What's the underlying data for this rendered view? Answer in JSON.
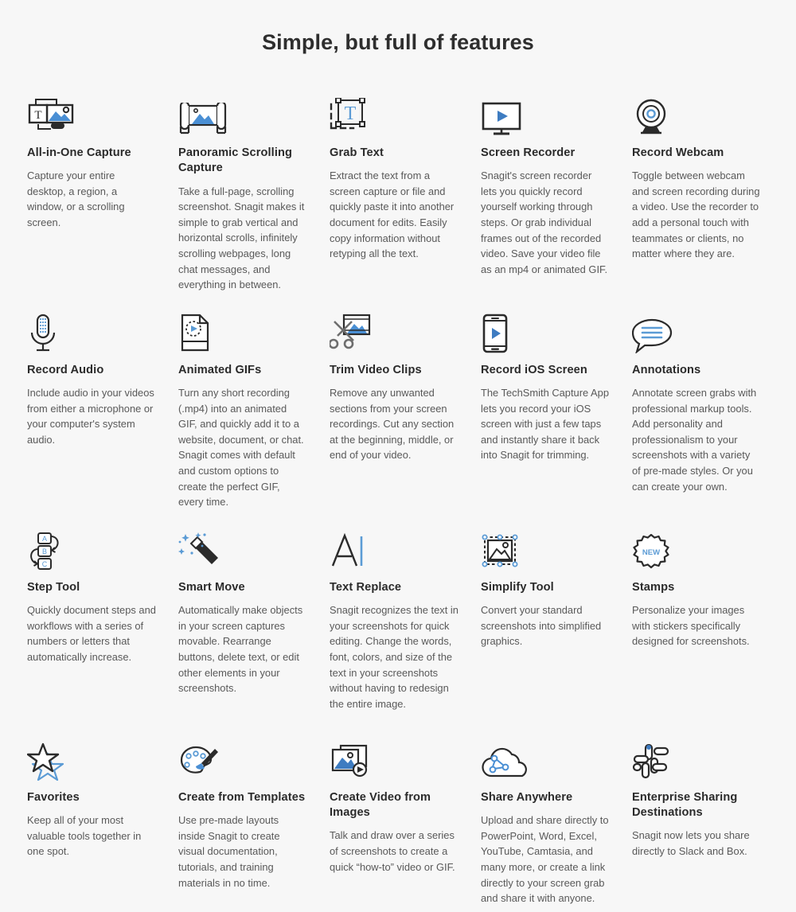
{
  "header": {
    "title": "Simple, but full of features"
  },
  "colors": {
    "accent": "#3e7cc1",
    "accent_light": "#5b9bd5",
    "ink": "#2b2b2b",
    "body_text": "#595959",
    "background": "#f7f7f7"
  },
  "features": [
    {
      "icon": "all-in-one-capture-icon",
      "title": "All-in-One Capture",
      "desc": "Capture your entire desktop, a region, a window, or a scrolling screen."
    },
    {
      "icon": "panoramic-scrolling-capture-icon",
      "title": "Panoramic Scrolling Capture",
      "desc": "Take a full-page, scrolling screenshot. Snagit makes it simple to grab vertical and horizontal scrolls, infinitely scrolling webpages, long chat messages, and everything in between."
    },
    {
      "icon": "grab-text-icon",
      "title": "Grab Text",
      "desc": "Extract the text from a screen capture or file and quickly paste it into another document for edits. Easily copy information without retyping all the text."
    },
    {
      "icon": "screen-recorder-icon",
      "title": "Screen Recorder",
      "desc": "Snagit's screen recorder lets you quickly record yourself working through steps. Or grab individual frames out of the recorded video. Save your video file as an mp4 or animated GIF."
    },
    {
      "icon": "record-webcam-icon",
      "title": "Record Webcam",
      "desc": "Toggle between webcam and screen recording during a video. Use the recorder to add a personal touch with teammates or clients, no matter where they are."
    },
    {
      "icon": "record-audio-icon",
      "title": "Record Audio",
      "desc": "Include audio in your videos from either a microphone or your computer's system audio."
    },
    {
      "icon": "animated-gifs-icon",
      "title": "Animated GIFs",
      "desc": "Turn any short recording (.mp4) into an animated GIF, and quickly add it to a website, document, or chat. Snagit comes with default and custom options to create the perfect GIF, every time."
    },
    {
      "icon": "trim-video-clips-icon",
      "title": "Trim Video Clips",
      "desc": "Remove any unwanted sections from your screen recordings. Cut any section at the beginning, middle, or end of your video."
    },
    {
      "icon": "record-ios-screen-icon",
      "title": "Record iOS Screen",
      "desc": "The TechSmith Capture App lets you record your iOS screen with just a few taps and instantly share it back into Snagit for trimming."
    },
    {
      "icon": "annotations-icon",
      "title": "Annotations",
      "desc": "Annotate screen grabs with professional markup tools. Add personality and professionalism to your screenshots with a variety of pre-made styles. Or you can create your own."
    },
    {
      "icon": "step-tool-icon",
      "title": "Step Tool",
      "desc": "Quickly document steps and workflows with a series of numbers or letters that automatically increase."
    },
    {
      "icon": "smart-move-icon",
      "title": "Smart Move",
      "desc": "Automatically make objects in your screen captures movable. Rearrange buttons, delete text, or edit other elements in your screenshots."
    },
    {
      "icon": "text-replace-icon",
      "title": "Text Replace",
      "desc": "Snagit recognizes the text in your screenshots for quick editing. Change the words, font, colors, and size of the text in your screenshots without having to redesign the entire image."
    },
    {
      "icon": "simplify-tool-icon",
      "title": "Simplify Tool",
      "desc": "Convert your standard screenshots into simplified graphics."
    },
    {
      "icon": "stamps-icon",
      "title": "Stamps",
      "desc": "Personalize your images with stickers specifically designed for screenshots.",
      "badge": "NEW"
    },
    {
      "icon": "favorites-icon",
      "title": "Favorites",
      "desc": "Keep all of your most valuable tools together in one spot."
    },
    {
      "icon": "create-from-templates-icon",
      "title": "Create from Templates",
      "desc": "Use pre-made layouts inside Snagit to create visual documentation, tutorials, and training materials in no time."
    },
    {
      "icon": "create-video-from-images-icon",
      "title": "Create Video from Images",
      "desc": "Talk and draw over a series of screenshots to create a quick “how-to” video or GIF."
    },
    {
      "icon": "share-anywhere-icon",
      "title": "Share Anywhere",
      "desc": "Upload and share directly to PowerPoint, Word, Excel, YouTube, Camtasia, and many more, or create a link directly to your screen grab and share it with anyone."
    },
    {
      "icon": "enterprise-sharing-destinations-icon",
      "title": "Enterprise Sharing Destinations",
      "desc": "Snagit now lets you share directly to Slack and Box."
    }
  ]
}
